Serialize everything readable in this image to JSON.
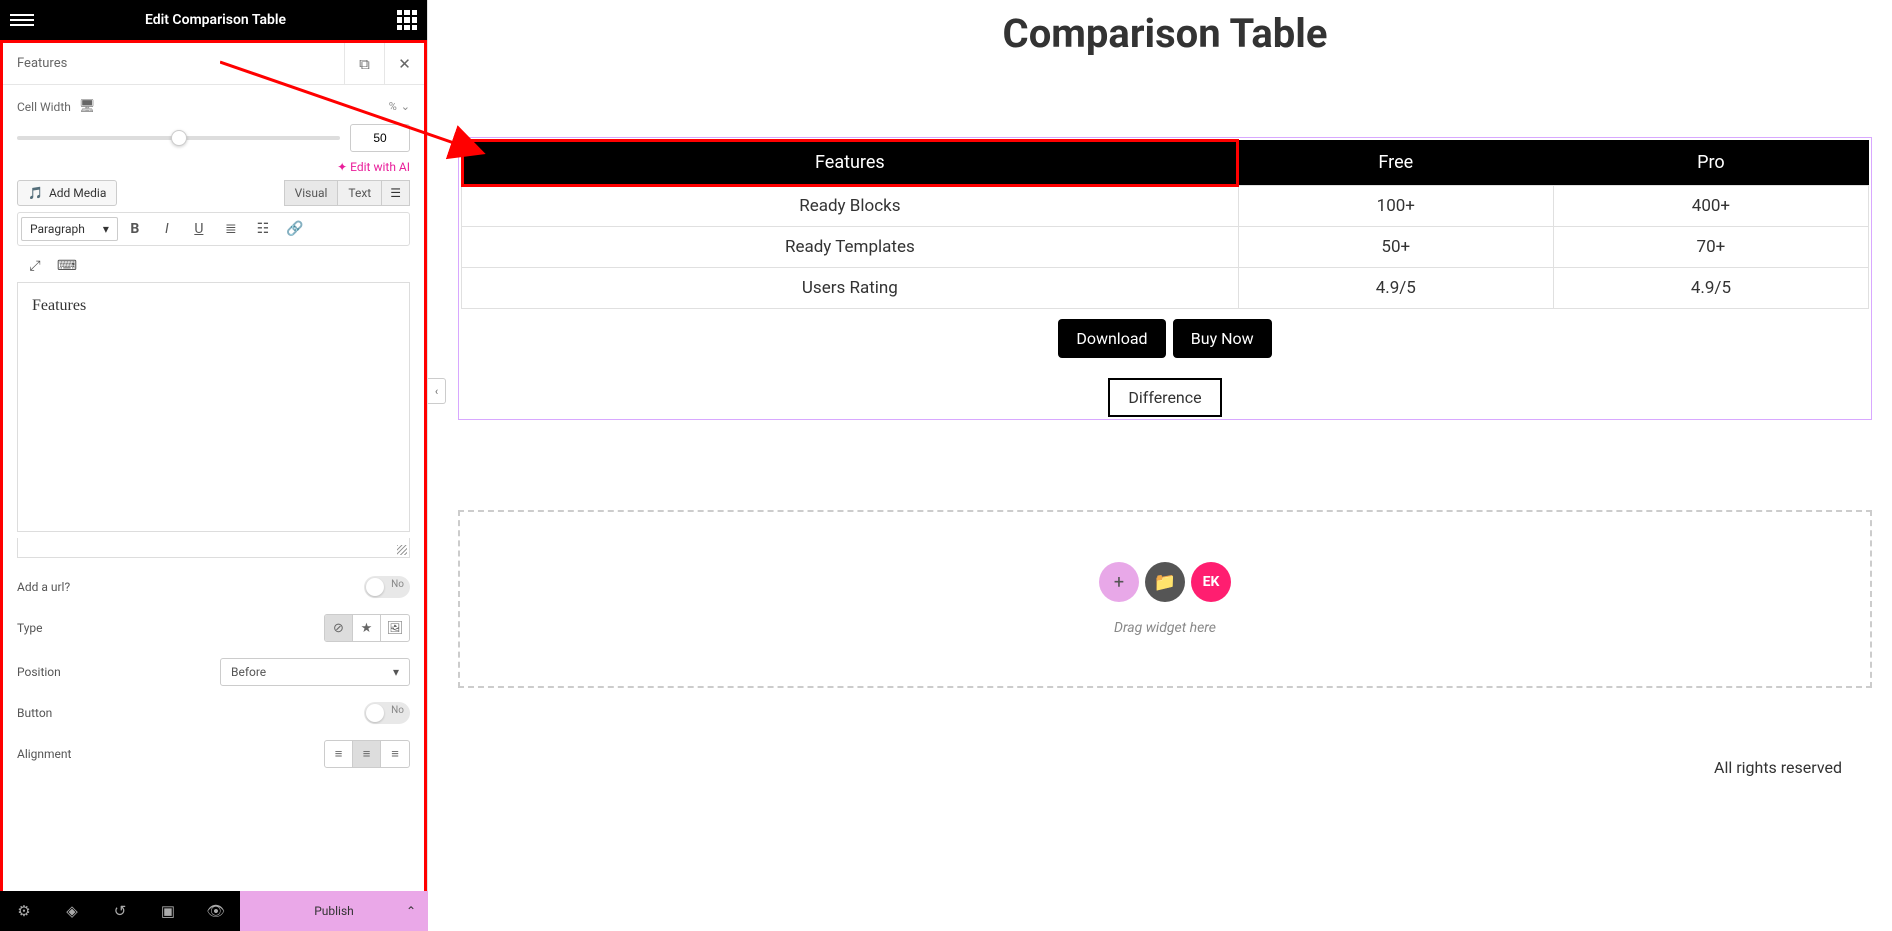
{
  "panel": {
    "title": "Edit Comparison Table",
    "section_title": "Features",
    "cell_width_label": "Cell Width",
    "cell_width_unit": "%",
    "cell_width_value": "50",
    "edit_ai": "✦ Edit with AI",
    "add_media": "Add Media",
    "tab_visual": "Visual",
    "tab_text": "Text",
    "paragraph": "Paragraph",
    "editor_content": "Features",
    "add_url_label": "Add a url?",
    "add_url_value": "No",
    "type_label": "Type",
    "position_label": "Position",
    "position_value": "Before",
    "button_label": "Button",
    "button_value": "No",
    "alignment_label": "Alignment"
  },
  "bottombar": {
    "publish": "Publish"
  },
  "canvas": {
    "page_title": "Comparison Table",
    "headers": [
      "Features",
      "Free",
      "Pro"
    ],
    "rows": [
      [
        "Ready Blocks",
        "100+",
        "400+"
      ],
      [
        "Ready Templates",
        "50+",
        "70+"
      ],
      [
        "Users Rating",
        "4.9/5",
        "4.9/5"
      ]
    ],
    "download": "Download",
    "buy_now": "Buy Now",
    "difference": "Difference",
    "drag_text": "Drag widget here",
    "footer": "All rights reserved"
  }
}
